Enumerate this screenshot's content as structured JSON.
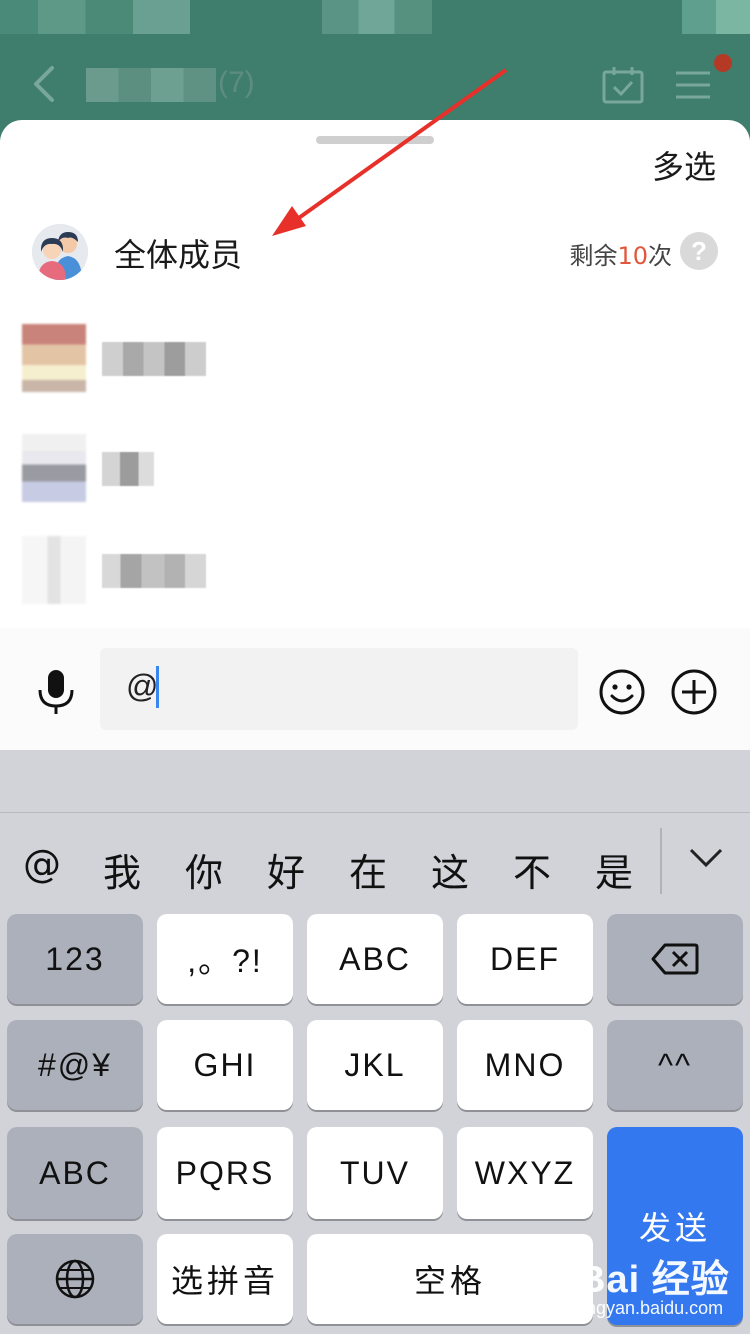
{
  "header": {
    "member_count": "(7)",
    "colors": {
      "background": "#3f7d6c",
      "notification_dot": "#b43a26"
    },
    "icons": [
      "back-arrow-icon",
      "calendar-check-icon",
      "menu-icon"
    ]
  },
  "sheet": {
    "multi_select_label": "多选",
    "all_members": {
      "label": "全体成员",
      "remaining_prefix": "剩余",
      "remaining_count": "10",
      "remaining_suffix": "次",
      "help_symbol": "?"
    }
  },
  "input_bar": {
    "value": "@",
    "icons": [
      "microphone-icon",
      "emoji-icon",
      "plus-icon"
    ]
  },
  "keyboard": {
    "candidates": [
      "@",
      "我",
      "你",
      "好",
      "在",
      "这",
      "不",
      "是"
    ],
    "rows": [
      [
        "123",
        ",。?!",
        "ABC",
        "DEF",
        "⌫"
      ],
      [
        "#@¥",
        "GHI",
        "JKL",
        "MNO",
        "^^"
      ],
      [
        "ABC",
        "PQRS",
        "TUV",
        "WXYZ",
        "发送"
      ],
      [
        "🌐",
        "选拼音",
        "空格"
      ]
    ],
    "keys": {
      "num": "123",
      "punct": ",。?!",
      "abc": "ABC",
      "def": "DEF",
      "symbols": "#@¥",
      "ghi": "GHI",
      "jkl": "JKL",
      "mno": "MNO",
      "emoticon": "^^",
      "abc_switch": "ABC",
      "pqrs": "PQRS",
      "tuv": "TUV",
      "wxyz": "WXYZ",
      "send": "发送",
      "pinyin": "选拼音",
      "space": "空格"
    },
    "colors": {
      "send": "#3478f0",
      "function_key": "#abb0bb",
      "key": "#ffffff"
    }
  },
  "watermark": {
    "text": "Bai 经验",
    "sub": "jingyan.baidu.com"
  }
}
